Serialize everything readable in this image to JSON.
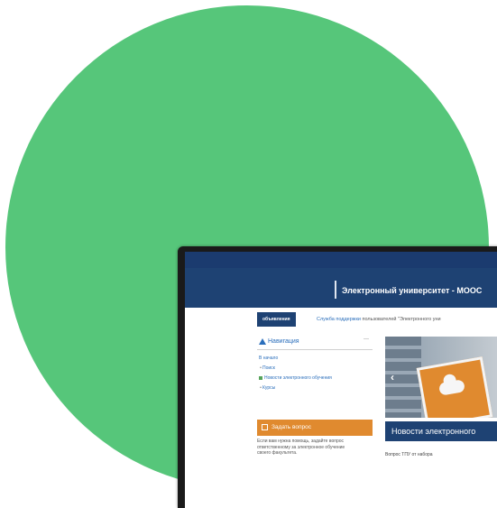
{
  "site": {
    "title": "Электронный университет - MOOC"
  },
  "toolbar": {
    "tab_label": "объявления",
    "support_link": "Служба поддержки",
    "support_rest": " пользователей \"Электронного уни"
  },
  "nav": {
    "title": "Навигация",
    "collapse": "—",
    "items": [
      {
        "label": "В начало"
      },
      {
        "label": "Поиск"
      },
      {
        "label": "Новости электронного обучения"
      },
      {
        "label": "Курсы"
      }
    ]
  },
  "ask": {
    "label": "Задать вопрос",
    "text": "Если вам нужна помощь, задайте вопрос ответственному за электронное обучение своего факультета."
  },
  "banner": {
    "prev_arrow": "‹"
  },
  "news": {
    "header": "Новости электронного",
    "first_item": "Вопрос ТПУ от набора"
  },
  "colors": {
    "circle": "#56c67a",
    "brand_blue": "#1e4273",
    "accent_orange": "#e08a2f",
    "link_blue": "#2a6ebb"
  }
}
